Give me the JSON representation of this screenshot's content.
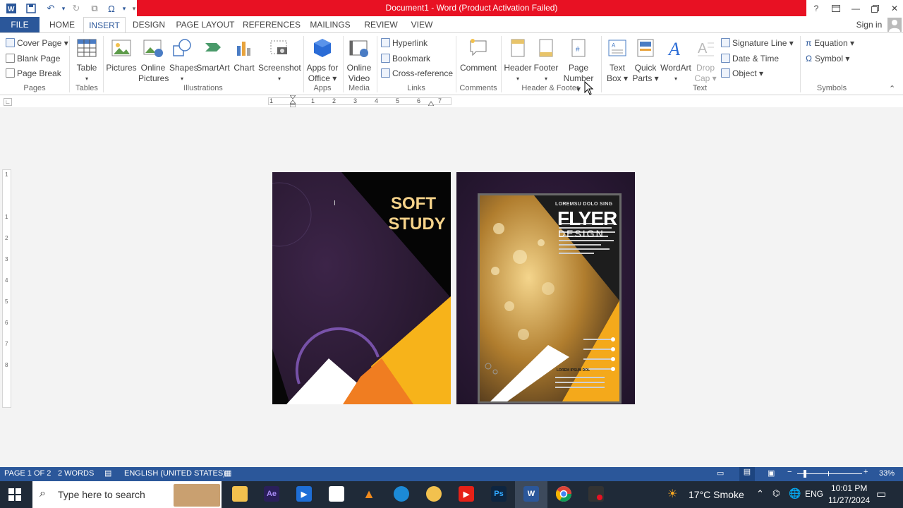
{
  "title_bar": {
    "title": "Document1 - Word (Product Activation Failed)",
    "help": "?",
    "accent": "#e81123"
  },
  "tabs": [
    {
      "label": "FILE"
    },
    {
      "label": "HOME"
    },
    {
      "label": "INSERT"
    },
    {
      "label": "DESIGN"
    },
    {
      "label": "PAGE LAYOUT"
    },
    {
      "label": "REFERENCES"
    },
    {
      "label": "MAILINGS"
    },
    {
      "label": "REVIEW"
    },
    {
      "label": "VIEW"
    }
  ],
  "sign_in": "Sign in",
  "ribbon": {
    "pages": {
      "label": "Pages",
      "cover_page": "Cover Page",
      "blank_page": "Blank Page",
      "page_break": "Page Break"
    },
    "tables": {
      "label": "Tables",
      "table": "Table"
    },
    "illustrations": {
      "label": "Illustrations",
      "pictures": "Pictures",
      "online_pictures_1": "Online",
      "online_pictures_2": "Pictures",
      "shapes": "Shapes",
      "smartart": "SmartArt",
      "chart": "Chart",
      "screenshot": "Screenshot"
    },
    "apps": {
      "label": "Apps",
      "apps_1": "Apps for",
      "apps_2": "Office"
    },
    "media": {
      "label": "Media",
      "video_1": "Online",
      "video_2": "Video"
    },
    "links": {
      "label": "Links",
      "hyperlink": "Hyperlink",
      "bookmark": "Bookmark",
      "crossref": "Cross-reference"
    },
    "comments": {
      "label": "Comments",
      "comment": "Comment"
    },
    "header_footer": {
      "label": "Header & Footer",
      "header": "Header",
      "footer": "Footer",
      "page_number_1": "Page",
      "page_number_2": "Number"
    },
    "text": {
      "label": "Text",
      "textbox_1": "Text",
      "textbox_2": "Box",
      "quickparts_1": "Quick",
      "quickparts_2": "Parts",
      "wordart": "WordArt",
      "dropcap_1": "Drop",
      "dropcap_2": "Cap",
      "signature": "Signature Line",
      "datetime": "Date & Time",
      "object": "Object"
    },
    "symbols": {
      "label": "Symbols",
      "equation": "Equation",
      "symbol": "Symbol"
    }
  },
  "ruler": {
    "ticks": [
      "1",
      "1",
      "2",
      "3",
      "4",
      "5",
      "6",
      "7"
    ]
  },
  "vruler": {
    "ticks": [
      "1",
      "1",
      "2",
      "3",
      "4",
      "5",
      "6",
      "7",
      "8"
    ]
  },
  "page1": {
    "line1": "SOFT",
    "line2": "STUDY"
  },
  "page2": {
    "small_heading": "LOREMSU DOLO SING",
    "big_title": "FLYER",
    "sub_title": "DESIGN",
    "section": "LOREM IPSUM DOL"
  },
  "status_bar": {
    "page": "PAGE 1 OF 2",
    "words": "2 WORDS",
    "language": "ENGLISH (UNITED STATES)",
    "zoom": "33%"
  },
  "taskbar": {
    "search_placeholder": "Type here to search",
    "weather": "17°C  Smoke",
    "language": "ENG",
    "time": "10:01 PM",
    "date": "11/27/2024"
  }
}
